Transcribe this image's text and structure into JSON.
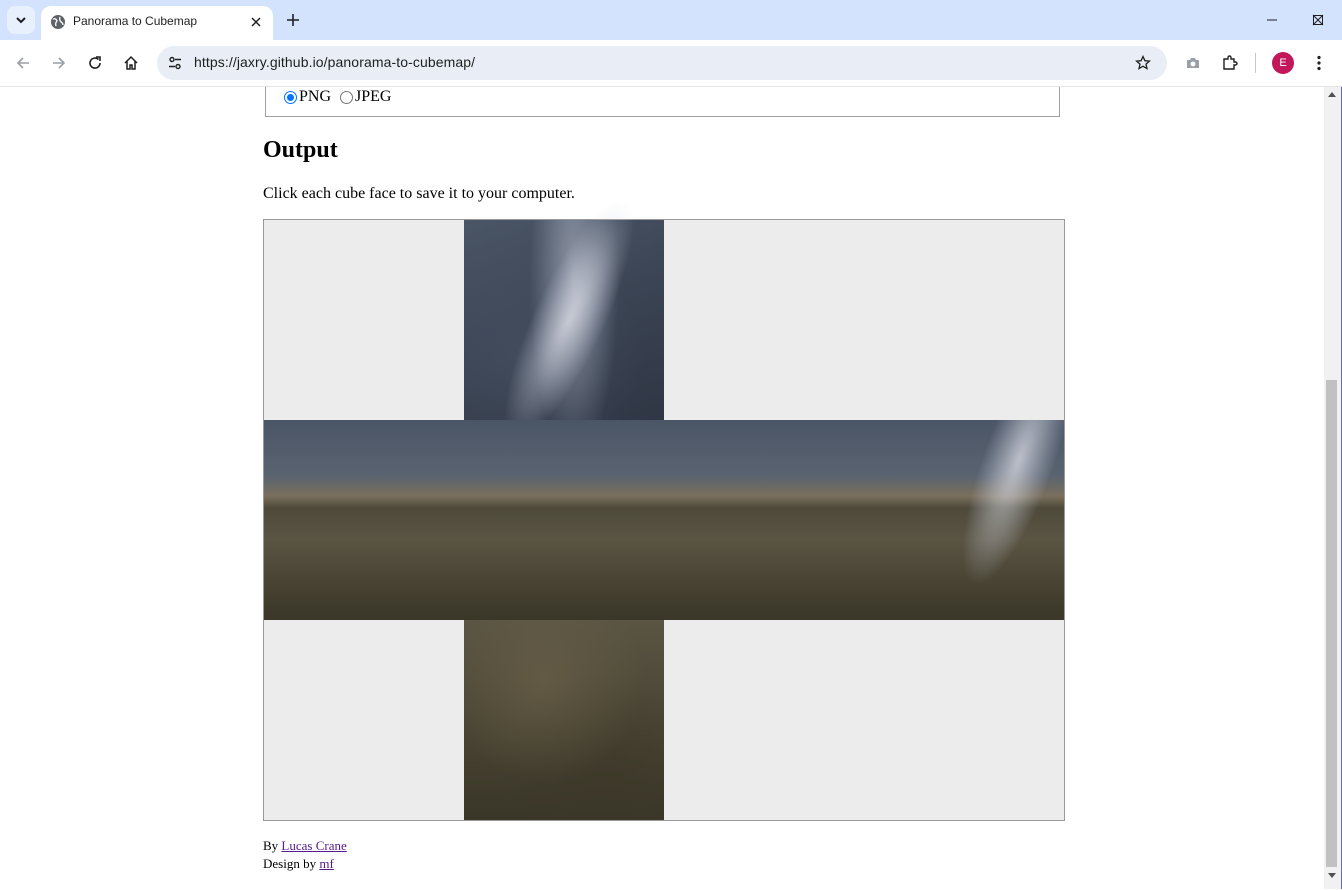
{
  "browser": {
    "tab_title": "Panorama to Cubemap",
    "url": "https://jaxry.github.io/panorama-to-cubemap/",
    "profile_initial": "E",
    "icons": {
      "tab_list": "chevron-down-icon",
      "favicon": "globe-icon",
      "tab_close": "close-icon",
      "new_tab": "plus-icon",
      "back": "arrow-left-icon",
      "forward": "arrow-right-icon",
      "reload": "reload-icon",
      "home": "home-icon",
      "site_info": "tune-icon",
      "bookmark": "star-icon",
      "screenshot": "camera-icon",
      "extensions": "puzzle-icon",
      "menu": "kebab-menu-icon",
      "minimize": "minimize-icon",
      "maximize": "maximize-icon",
      "close_window": "close-icon"
    }
  },
  "format": {
    "options": [
      "PNG",
      "JPEG"
    ],
    "selected": "PNG"
  },
  "output": {
    "heading": "Output",
    "description": "Click each cube face to save it to your computer."
  },
  "footer": {
    "by_label": "By",
    "author": "Lucas Crane",
    "design_label": "Design by",
    "designer": "mf"
  },
  "colors": {
    "tab_strip": "#d3e3fd",
    "omnibox": "#e9eef6",
    "avatar": "#c2185b",
    "radio_accent": "#0075ff",
    "cube_background": "#ececec",
    "visited_link": "#551a8b"
  }
}
